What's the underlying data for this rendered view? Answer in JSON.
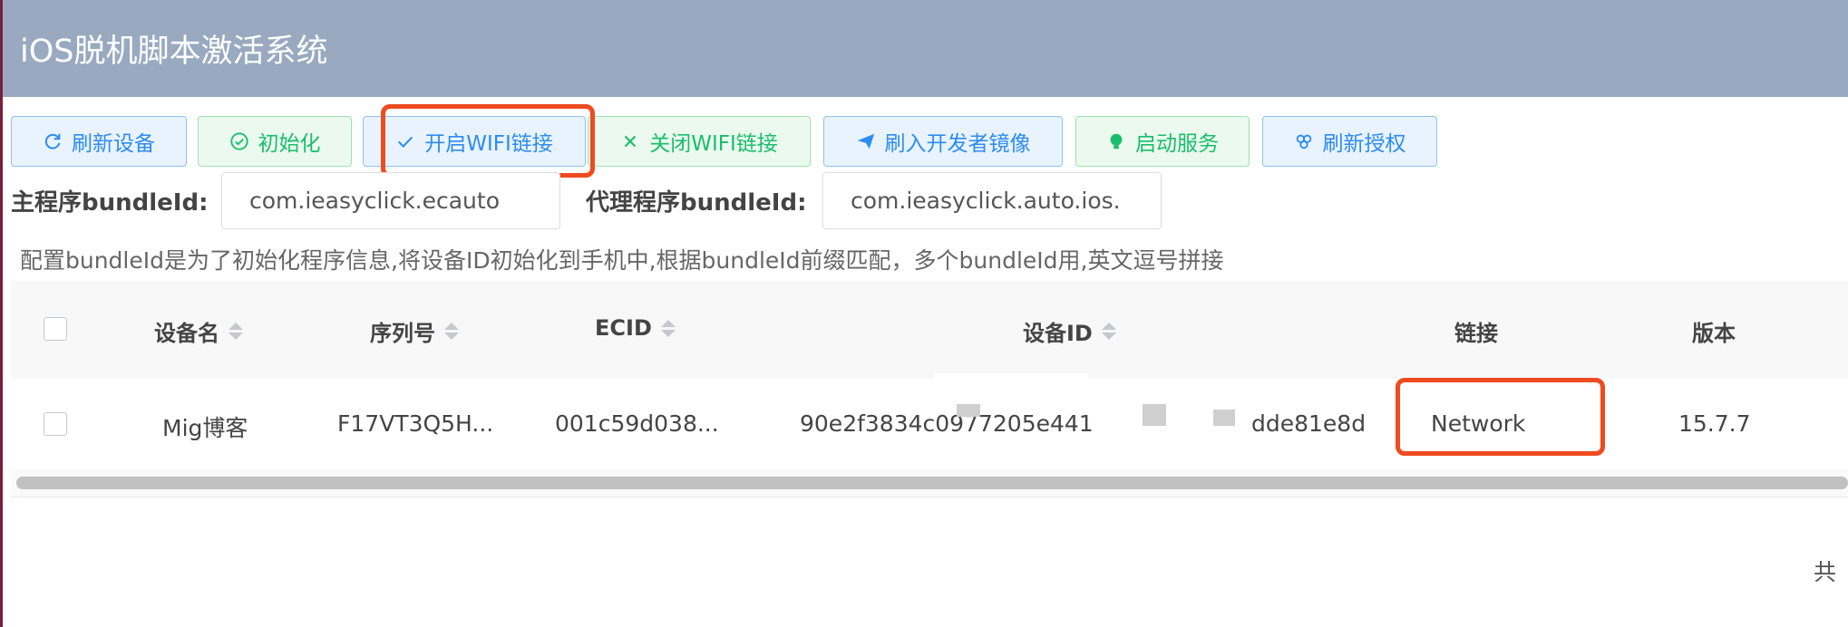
{
  "app": {
    "title": "iOS脱机脚本激活系统"
  },
  "toolbar": {
    "buttons": [
      {
        "label": "刷新设备",
        "icon": "refresh-icon",
        "style": "blue"
      },
      {
        "label": "初始化",
        "icon": "check-circle-icon",
        "style": "green"
      },
      {
        "label": "开启WIFI链接",
        "icon": "checkmark-icon",
        "style": "blue"
      },
      {
        "label": "关闭WIFI链接",
        "icon": "close-icon",
        "style": "green"
      },
      {
        "label": "刷入开发者镜像",
        "icon": "paper-plane-icon",
        "style": "blue"
      },
      {
        "label": "启动服务",
        "icon": "bulb-icon",
        "style": "green"
      },
      {
        "label": "刷新授权",
        "icon": "sync-icon",
        "style": "blue"
      }
    ]
  },
  "form": {
    "main_bundle_label": "主程序bundleId:",
    "main_bundle_value": "com.ieasyclick.ecauto",
    "proxy_bundle_label": "代理程序bundleId:",
    "proxy_bundle_value": "com.ieasyclick.auto.ios."
  },
  "hint": "配置bundleId是为了初始化程序信息,将设备ID初始化到手机中,根据bundleId前缀匹配，多个bundleId用,英文逗号拼接",
  "table": {
    "columns": [
      "设备名",
      "序列号",
      "ECID",
      "设备ID",
      "链接",
      "版本"
    ],
    "rows": [
      {
        "name": "Mig博客",
        "serial": "F17VT3Q5H...",
        "ecid": "001c59d038...",
        "device_id_start": "90e2f3834c0977205e441",
        "device_id_end": "dde81e8d",
        "link": "Network",
        "version": "15.7.7"
      }
    ]
  },
  "pager": {
    "total_prefix": "共"
  },
  "colors": {
    "header_bg": "#98a9c0",
    "highlight": "#ee4b1f",
    "blue": "#2d8cf0",
    "green": "#19be6b"
  }
}
